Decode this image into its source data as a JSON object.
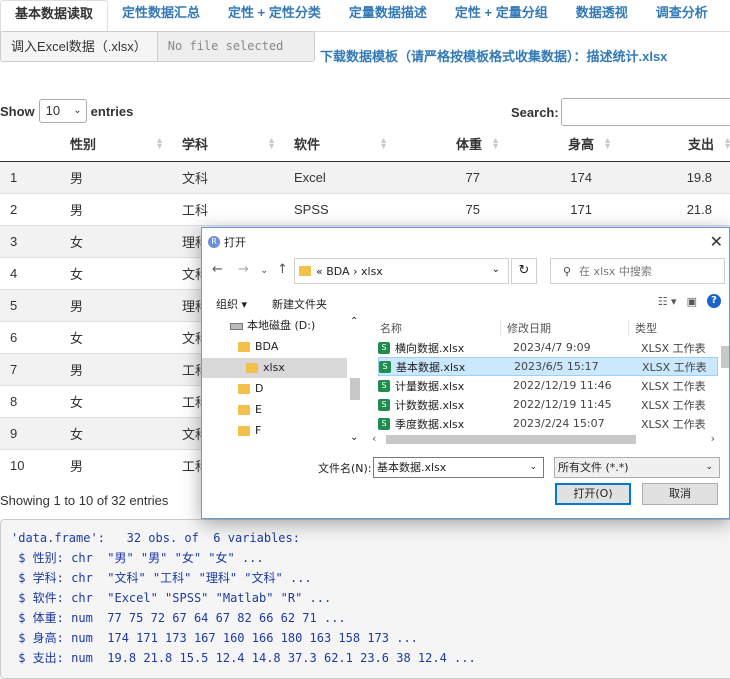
{
  "tabs": [
    "基本数据读取",
    "定性数据汇总",
    "定性 + 定性分类",
    "定量数据描述",
    "定性 + 定量分组",
    "数据透视",
    "调查分析"
  ],
  "upload": {
    "button_label": "调入Excel数据（.xlsx）",
    "file_placeholder": "No file selected",
    "download_link": "下载数据模板（请严格按模板格式收集数据）：描述统计.xlsx"
  },
  "table_controls": {
    "show_label": "Show",
    "length_value": "10",
    "entries_label": "entries",
    "search_label": "Search:"
  },
  "table": {
    "columns": [
      "",
      "性别",
      "学科",
      "软件",
      "体重",
      "身高",
      "支出"
    ],
    "rows": [
      [
        "1",
        "男",
        "文科",
        "Excel",
        "77",
        "174",
        "19.8"
      ],
      [
        "2",
        "男",
        "工科",
        "SPSS",
        "75",
        "171",
        "21.8"
      ],
      [
        "3",
        "女",
        "理科",
        "",
        "",
        "",
        ""
      ],
      [
        "4",
        "女",
        "文科",
        "",
        "",
        "",
        ""
      ],
      [
        "5",
        "男",
        "理科",
        "",
        "",
        "",
        ""
      ],
      [
        "6",
        "女",
        "文科",
        "",
        "",
        "",
        ""
      ],
      [
        "7",
        "男",
        "工科",
        "",
        "",
        "",
        ""
      ],
      [
        "8",
        "女",
        "工科",
        "",
        "",
        "",
        ""
      ],
      [
        "9",
        "女",
        "文科",
        "",
        "",
        "",
        ""
      ],
      [
        "10",
        "男",
        "工科",
        "",
        "",
        "",
        ""
      ]
    ],
    "info": "Showing 1 to 10 of 32 entries"
  },
  "console": {
    "lines": [
      "'data.frame':   32 obs. of  6 variables:",
      " $ 性别: chr  \"男\" \"男\" \"女\" \"女\" ...",
      " $ 学科: chr  \"文科\" \"工科\" \"理科\" \"文科\" ...",
      " $ 软件: chr  \"Excel\" \"SPSS\" \"Matlab\" \"R\" ...",
      " $ 体重: num  77 75 72 67 64 67 82 66 62 71 ...",
      " $ 身高: num  174 171 173 167 160 166 180 163 158 173 ...",
      " $ 支出: num  19.8 21.8 15.5 12.4 14.8 37.3 62.1 23.6 38 12.4 ..."
    ]
  },
  "dialog": {
    "title": "打开",
    "address": [
      "«",
      "BDA",
      "›",
      "xlsx"
    ],
    "search_placeholder": "在 xlsx 中搜索",
    "toolbar": {
      "organize": "组织 ▾",
      "new_folder": "新建文件夹"
    },
    "nav": [
      {
        "label": "本地磁盘 (D:)",
        "kind": "drive"
      },
      {
        "label": "BDA",
        "kind": "folder"
      },
      {
        "label": "xlsx",
        "kind": "folder",
        "selected": true
      },
      {
        "label": "D",
        "kind": "folder"
      },
      {
        "label": "E",
        "kind": "folder"
      },
      {
        "label": "F",
        "kind": "folder"
      }
    ],
    "columns": {
      "name": "名称",
      "date": "修改日期",
      "type": "类型"
    },
    "files": [
      {
        "name": "横向数据.xlsx",
        "date": "2023/4/7 9:09",
        "type": "XLSX 工作表"
      },
      {
        "name": "基本数据.xlsx",
        "date": "2023/6/5 15:17",
        "type": "XLSX 工作表",
        "selected": true
      },
      {
        "name": "计量数据.xlsx",
        "date": "2022/12/19 11:46",
        "type": "XLSX 工作表"
      },
      {
        "name": "计数数据.xlsx",
        "date": "2022/12/19 11:45",
        "type": "XLSX 工作表"
      },
      {
        "name": "季度数据.xlsx",
        "date": "2023/2/24 15:07",
        "type": "XLSX 工作表"
      }
    ],
    "filename_label": "文件名(N):",
    "filename_value": "基本数据.xlsx",
    "filetype_value": "所有文件 (*.*)",
    "open_button": "打开(O)",
    "cancel_button": "取消"
  },
  "colors": {
    "link": "#337ab7",
    "console_text": "#1b3aa6",
    "selection": "#cce8ff",
    "excel_green": "#1f8e4d"
  }
}
